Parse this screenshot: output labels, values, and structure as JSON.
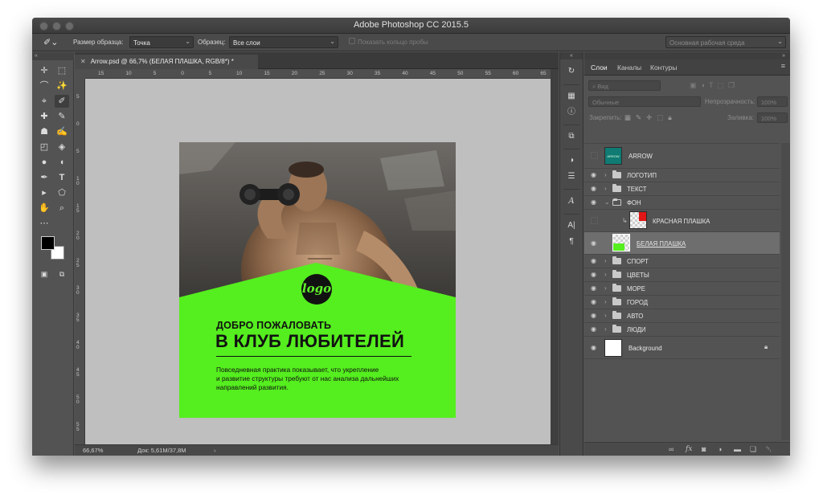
{
  "window": {
    "title": "Adobe Photoshop CC 2015.5"
  },
  "options_bar": {
    "sample_size_label": "Размер образца:",
    "sample_size_value": "Точка",
    "sample_label": "Образец:",
    "sample_value": "Все слои",
    "ring_label": "Показать кольцо пробы",
    "workspace": "Основная рабочая среда"
  },
  "document": {
    "tab_title": "Arrow.psd @ 66,7% (БЕЛАЯ ПЛАШКА, RGB/8*) *",
    "ruler_h_ticks": [
      "15",
      "10",
      "5",
      "0",
      "5",
      "10",
      "15",
      "20",
      "25",
      "30",
      "35",
      "40",
      "45",
      "50",
      "55",
      "60",
      "65"
    ],
    "ruler_v_ticks": [
      "5",
      "0",
      "5",
      "1 0",
      "1 5",
      "2 0",
      "2 5",
      "3 0",
      "3 5",
      "4 0",
      "4 5",
      "5 0",
      "5 5",
      "6 0"
    ],
    "zoom": "66,67%",
    "doc_size": "Док: 5,61M/37,8M"
  },
  "artwork": {
    "logo": "logo",
    "headline_small": "ДОБРО ПОЖАЛОВАТЬ",
    "headline_big": "В КЛУБ ЛЮБИТЕЛЕЙ",
    "body": [
      "Повседневная практика показывает, что укрепление",
      "и развитие структуры требуют от нас анализа дальнейших",
      "направлений развития."
    ],
    "accent": "#55ee1f"
  },
  "panel": {
    "tabs": [
      "Слои",
      "Каналы",
      "Контуры"
    ],
    "filter_placeholder": "Вид",
    "blend_mode": "Обычные",
    "opacity_label": "Непрозрачность:",
    "opacity_value": "100%",
    "lock_label": "Закрепить:",
    "fill_label": "Заливка:",
    "fill_value": "100%",
    "layers": [
      {
        "name": "ARROW",
        "kind": "smart",
        "visible": false
      },
      {
        "name": "ЛОГОТИП",
        "kind": "group",
        "visible": true
      },
      {
        "name": "ТЕКСТ",
        "kind": "group",
        "visible": true
      },
      {
        "name": "ФОН",
        "kind": "group-open",
        "visible": true
      },
      {
        "name": "КРАСНАЯ ПЛАШКА",
        "kind": "clip-shape",
        "visible": false
      },
      {
        "name": "БЕЛАЯ ПЛАШКА",
        "kind": "shape",
        "visible": true,
        "selected": true
      },
      {
        "name": "СПОРТ",
        "kind": "group",
        "visible": true
      },
      {
        "name": "ЦВЕТЫ",
        "kind": "group",
        "visible": true
      },
      {
        "name": "МОРЕ",
        "kind": "group",
        "visible": true
      },
      {
        "name": "ГОРОД",
        "kind": "group",
        "visible": true
      },
      {
        "name": "АВТО",
        "kind": "group",
        "visible": true
      },
      {
        "name": "ЛЮДИ",
        "kind": "group",
        "visible": true
      },
      {
        "name": "Background",
        "kind": "background",
        "visible": true
      }
    ],
    "footer_icons": [
      "link-icon",
      "fx-icon",
      "mask-icon",
      "adjustment-icon",
      "folder-icon",
      "new-layer-icon",
      "trash-icon"
    ]
  }
}
